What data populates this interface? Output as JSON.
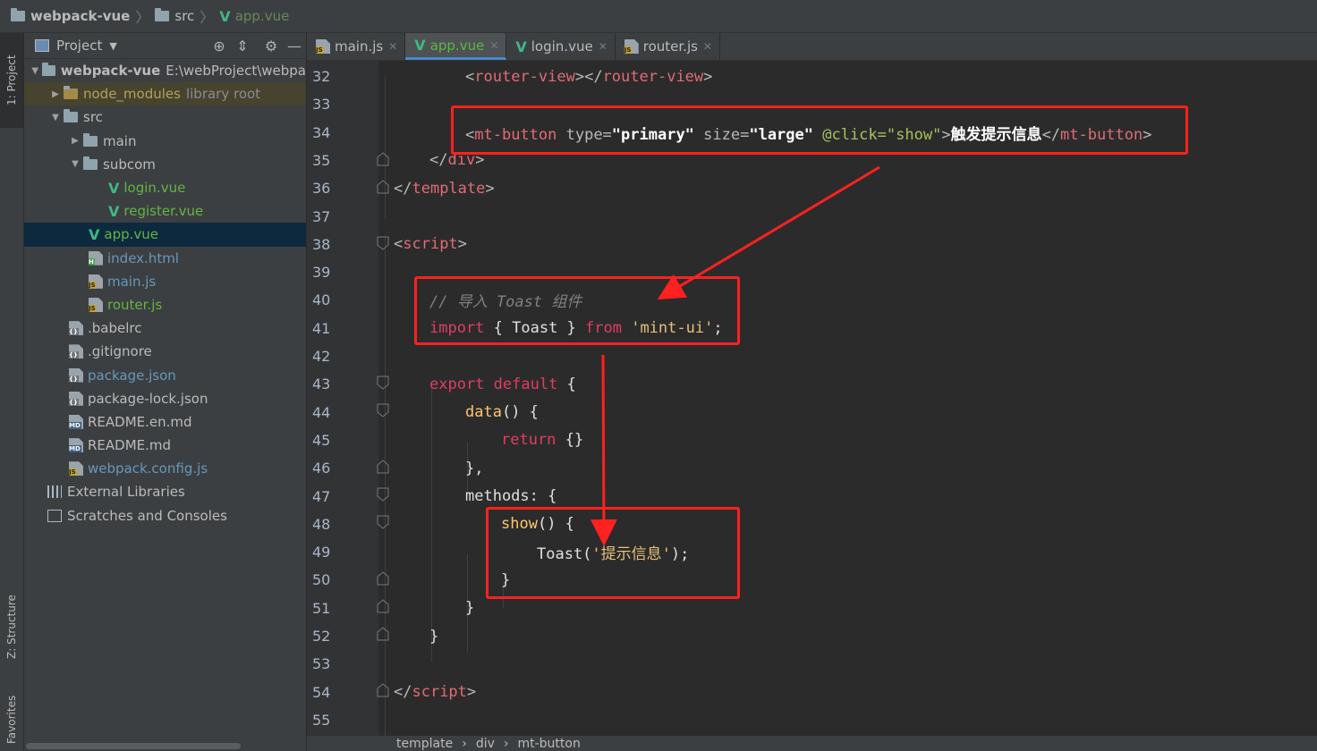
{
  "breadcrumb": {
    "project": "webpack-vue",
    "folder": "src",
    "file": "app.vue"
  },
  "side_tabs": {
    "project": "1: Project",
    "structure": "Z: Structure",
    "favorites": "Favorites"
  },
  "project_panel": {
    "title": "Project",
    "root_name": "webpack-vue",
    "root_path": "E:\\webProject\\webpa",
    "items": [
      {
        "label": "node_modules",
        "suffix": "library root"
      },
      {
        "label": "src"
      },
      {
        "label": "main"
      },
      {
        "label": "subcom"
      },
      {
        "label": "login.vue"
      },
      {
        "label": "register.vue"
      },
      {
        "label": "app.vue"
      },
      {
        "label": "index.html"
      },
      {
        "label": "main.js"
      },
      {
        "label": "router.js"
      },
      {
        "label": ".babelrc"
      },
      {
        "label": ".gitignore"
      },
      {
        "label": "package.json"
      },
      {
        "label": "package-lock.json"
      },
      {
        "label": "README.en.md"
      },
      {
        "label": "README.md"
      },
      {
        "label": "webpack.config.js"
      },
      {
        "label": "External Libraries"
      },
      {
        "label": "Scratches and Consoles"
      }
    ]
  },
  "tabs": [
    {
      "label": "main.js"
    },
    {
      "label": "app.vue"
    },
    {
      "label": "login.vue"
    },
    {
      "label": "router.js"
    }
  ],
  "code": {
    "line_numbers": [
      "32",
      "33",
      "34",
      "35",
      "36",
      "37",
      "38",
      "39",
      "40",
      "41",
      "42",
      "43",
      "44",
      "45",
      "46",
      "47",
      "48",
      "49",
      "50",
      "51",
      "52",
      "53",
      "54",
      "55"
    ],
    "l32": {
      "open": "<",
      "tag1": "router-view",
      "mid": "></",
      "tag2": "router-view",
      "close": ">"
    },
    "l34": {
      "open": "<",
      "tag": "mt-button",
      "a1": " type=",
      "v1": "\"primary\"",
      "a2": " size=",
      "v2": "\"large\"",
      "a3": " @click=",
      "v3": "\"show\"",
      "gt": ">",
      "text": "触发提示信息",
      "endopen": "</",
      "endtag": "mt-button",
      "endclose": ">"
    },
    "l35": {
      "open": "</",
      "tag": "div",
      "close": ">"
    },
    "l36": {
      "open": "</",
      "tag": "template",
      "close": ">"
    },
    "l38": {
      "open": "<",
      "tag": "script",
      "close": ">"
    },
    "l40": "// 导入 Toast 组件",
    "l41": {
      "kw": "import",
      "mid": " { Toast } ",
      "from": "from",
      "str": " 'mint-ui'",
      "end": ";"
    },
    "l43": {
      "kw1": "export",
      "kw2": " default",
      "rest": " {"
    },
    "l44": {
      "fn": "data",
      "rest": "() {"
    },
    "l45": {
      "kw": "return",
      "rest": " {}"
    },
    "l46": "},",
    "l47": {
      "name": "methods",
      "rest": ": {"
    },
    "l48": {
      "fn": "show",
      "rest": "() {"
    },
    "l49": {
      "call": "Toast(",
      "str": "'提示信息'",
      "end": ");"
    },
    "l50": "}",
    "l51": "}",
    "l52": "}",
    "l54": {
      "open": "</",
      "tag": "script",
      "close": ">"
    }
  },
  "status_path": [
    "template",
    "div",
    "mt-button"
  ],
  "annotation_color": "#ff2020",
  "colors": {
    "vue_green": "#41b883",
    "selection": "#0d293e",
    "tab_underline": "#4a88c7"
  }
}
